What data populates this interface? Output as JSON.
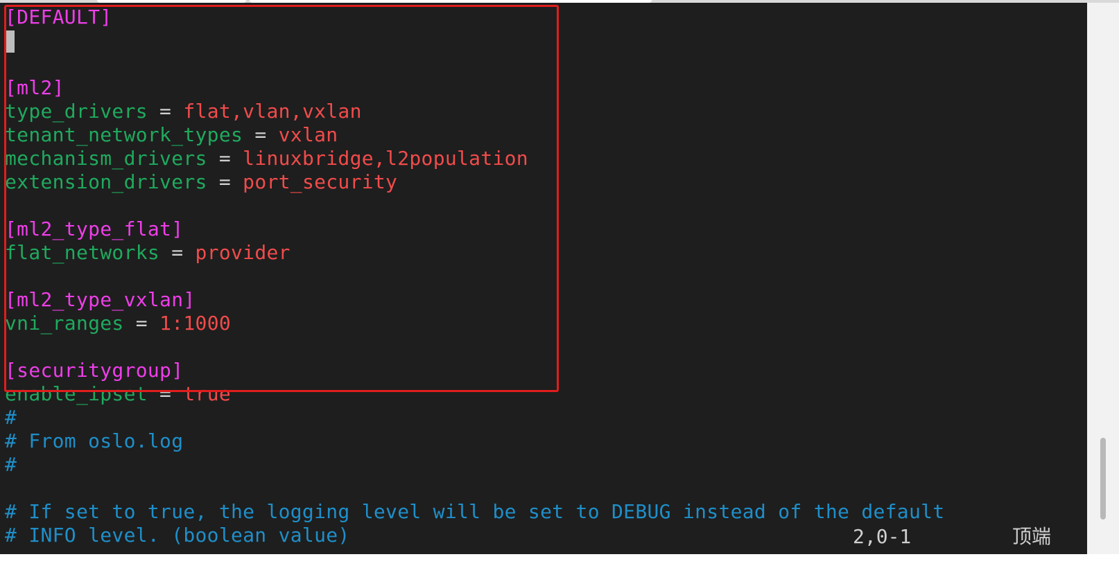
{
  "editor": {
    "lines": [
      {
        "type": "section",
        "text": "[DEFAULT]"
      },
      {
        "type": "cursor"
      },
      {
        "type": "blank"
      },
      {
        "type": "section",
        "text": "[ml2]"
      },
      {
        "type": "kv",
        "key": "type_drivers",
        "eq": " = ",
        "value": "flat,vlan,vxlan"
      },
      {
        "type": "kv",
        "key": "tenant_network_types",
        "eq": " = ",
        "value": "vxlan"
      },
      {
        "type": "kv",
        "key": "mechanism_drivers",
        "eq": " = ",
        "value": "linuxbridge,l2population"
      },
      {
        "type": "kv",
        "key": "extension_drivers",
        "eq": " = ",
        "value": "port_security"
      },
      {
        "type": "blank"
      },
      {
        "type": "section",
        "text": "[ml2_type_flat]"
      },
      {
        "type": "kv",
        "key": "flat_networks",
        "eq": " = ",
        "value": "provider"
      },
      {
        "type": "blank"
      },
      {
        "type": "section",
        "text": "[ml2_type_vxlan]"
      },
      {
        "type": "kv",
        "key": "vni_ranges",
        "eq": " = ",
        "value": "1:1000"
      },
      {
        "type": "blank"
      },
      {
        "type": "section",
        "text": "[securitygroup]"
      },
      {
        "type": "kv",
        "key": "enable_ipset",
        "eq": " = ",
        "value": "true"
      },
      {
        "type": "comment",
        "text": "#"
      },
      {
        "type": "comment",
        "text": "# From oslo.log"
      },
      {
        "type": "comment",
        "text": "#"
      },
      {
        "type": "blank"
      },
      {
        "type": "comment",
        "text": "# If set to true, the logging level will be set to DEBUG instead of the default"
      },
      {
        "type": "comment",
        "text": "# INFO level. (boolean value)"
      }
    ]
  },
  "status": {
    "position": "2,0-1",
    "scroll": "顶端"
  },
  "colors": {
    "background": "#1e1e1e",
    "section": "#ee3ee8",
    "key": "#1faa5e",
    "value": "#f24b4b",
    "comment": "#1e8fc9",
    "highlight_box": "#e11d1d"
  }
}
